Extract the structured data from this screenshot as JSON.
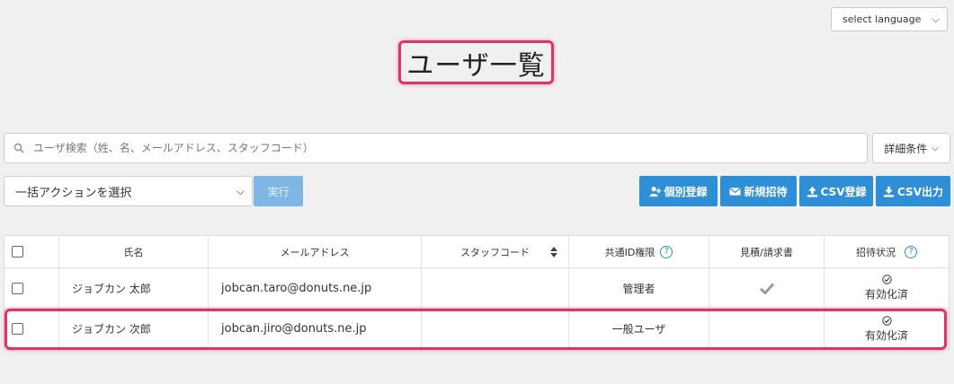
{
  "language": {
    "label": "select language"
  },
  "page": {
    "title": "ユーザ一覧"
  },
  "search": {
    "placeholder": "ユーザ検索（姓、名、メールアドレス、スタッフコード）"
  },
  "detail_button": {
    "label": "詳細条件"
  },
  "bulk": {
    "selected": "一括アクションを選択",
    "execute_label": "実行"
  },
  "actions": {
    "individual": "個別登録",
    "invite": "新規招待",
    "csv_register": "CSV登録",
    "csv_export": "CSV出力"
  },
  "table": {
    "headers": {
      "name": "氏名",
      "email": "メールアドレス",
      "staff_code": "スタッフコード",
      "shared_id": "共通ID権限",
      "estimate": "見積/請求書",
      "invite_status": "招待状況"
    },
    "rows": [
      {
        "name": "ジョブカン 太郎",
        "email": "jobcan.taro@donuts.ne.jp",
        "staff_code": "",
        "shared_id": "管理者",
        "estimate_check": true,
        "status": "有効化済"
      },
      {
        "name": "ジョブカン 次郎",
        "email": "jobcan.jiro@donuts.ne.jp",
        "staff_code": "",
        "shared_id": "一般ユーザ",
        "estimate_check": false,
        "status": "有効化済"
      }
    ]
  },
  "colors": {
    "accent": "#2e8fd6",
    "highlight": "#e0336b",
    "exec_disabled": "#7fb6e3"
  }
}
